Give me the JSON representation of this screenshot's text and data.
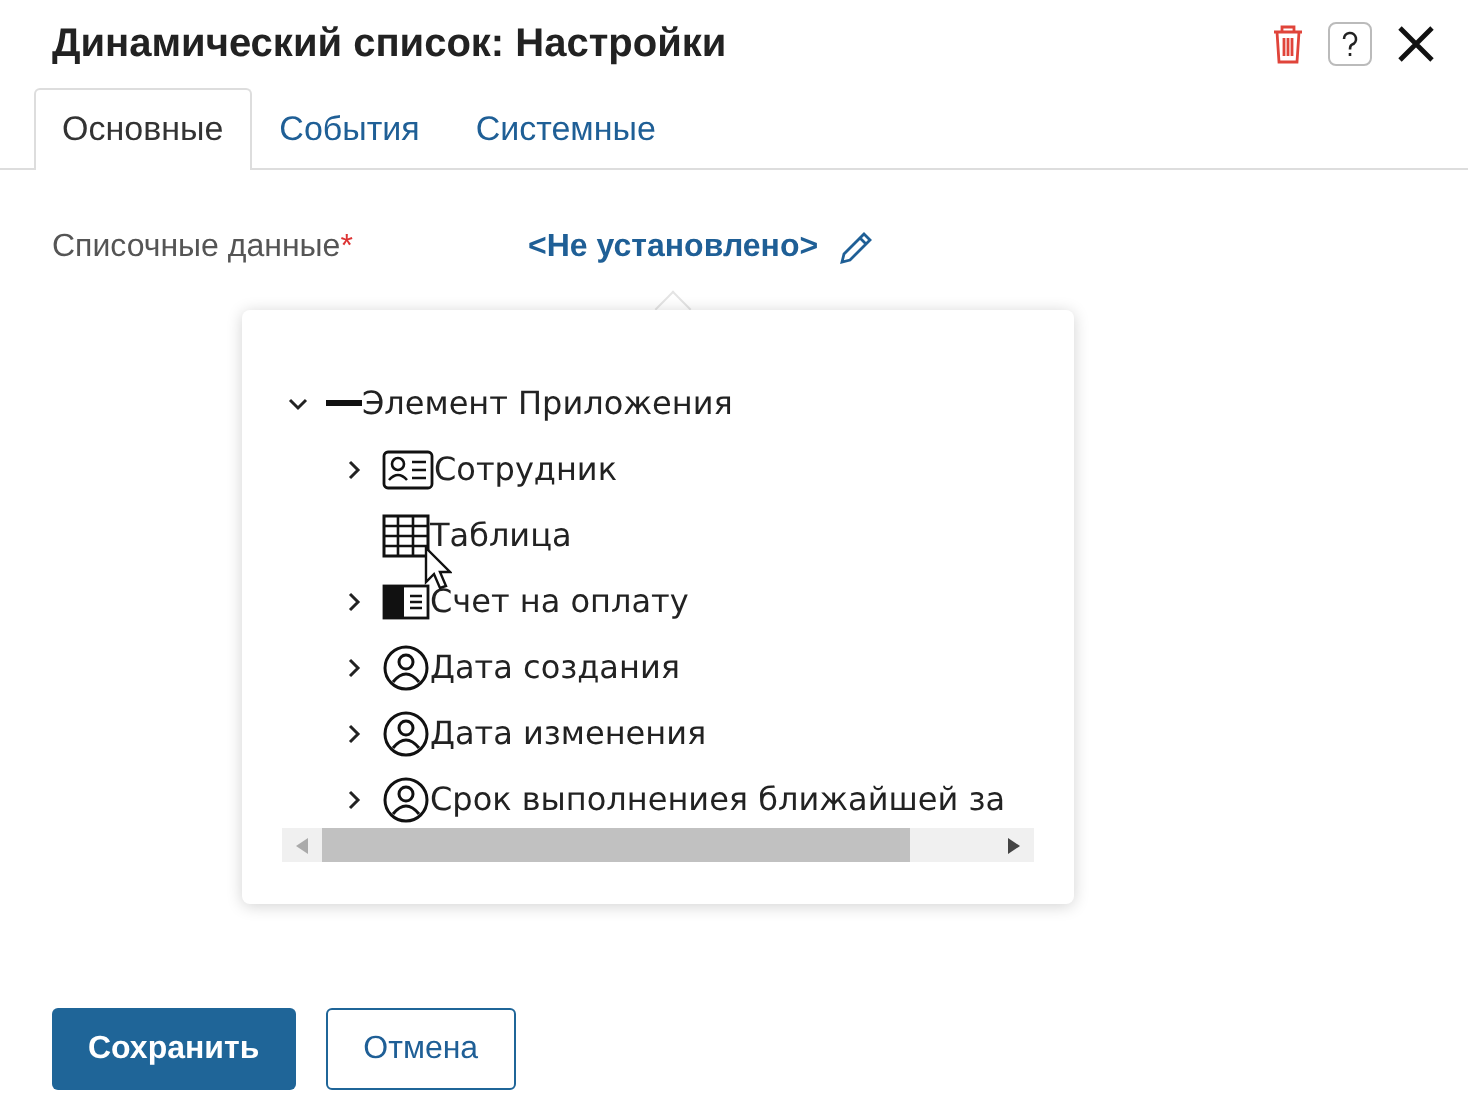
{
  "window": {
    "title": "Динамический список: Настройки"
  },
  "tabs": [
    {
      "label": "Основные",
      "selected": true
    },
    {
      "label": "События",
      "selected": false
    },
    {
      "label": "Системные",
      "selected": false
    }
  ],
  "field": {
    "label": "Списочные данные",
    "required_mark": "*",
    "value": "<Не установлено>"
  },
  "tree": [
    {
      "label": "Элемент Приложения",
      "kind": "collection",
      "expanded": true,
      "children": [
        {
          "label": "Сотрудник",
          "kind": "card",
          "expanded": false
        },
        {
          "label": "Таблица",
          "kind": "table"
        },
        {
          "label": "Счет на оплату",
          "kind": "document",
          "expanded": false
        },
        {
          "label": "Дата создания",
          "kind": "user",
          "expanded": false
        },
        {
          "label": "Дата изменения",
          "kind": "user",
          "expanded": false
        },
        {
          "label": "Срок выполнениея ближайшей за",
          "kind": "user",
          "expanded": false
        }
      ]
    }
  ],
  "buttons": [
    {
      "label": "Сохранить",
      "kind": "primary"
    },
    {
      "label": "Отмена",
      "kind": "secondary"
    }
  ]
}
